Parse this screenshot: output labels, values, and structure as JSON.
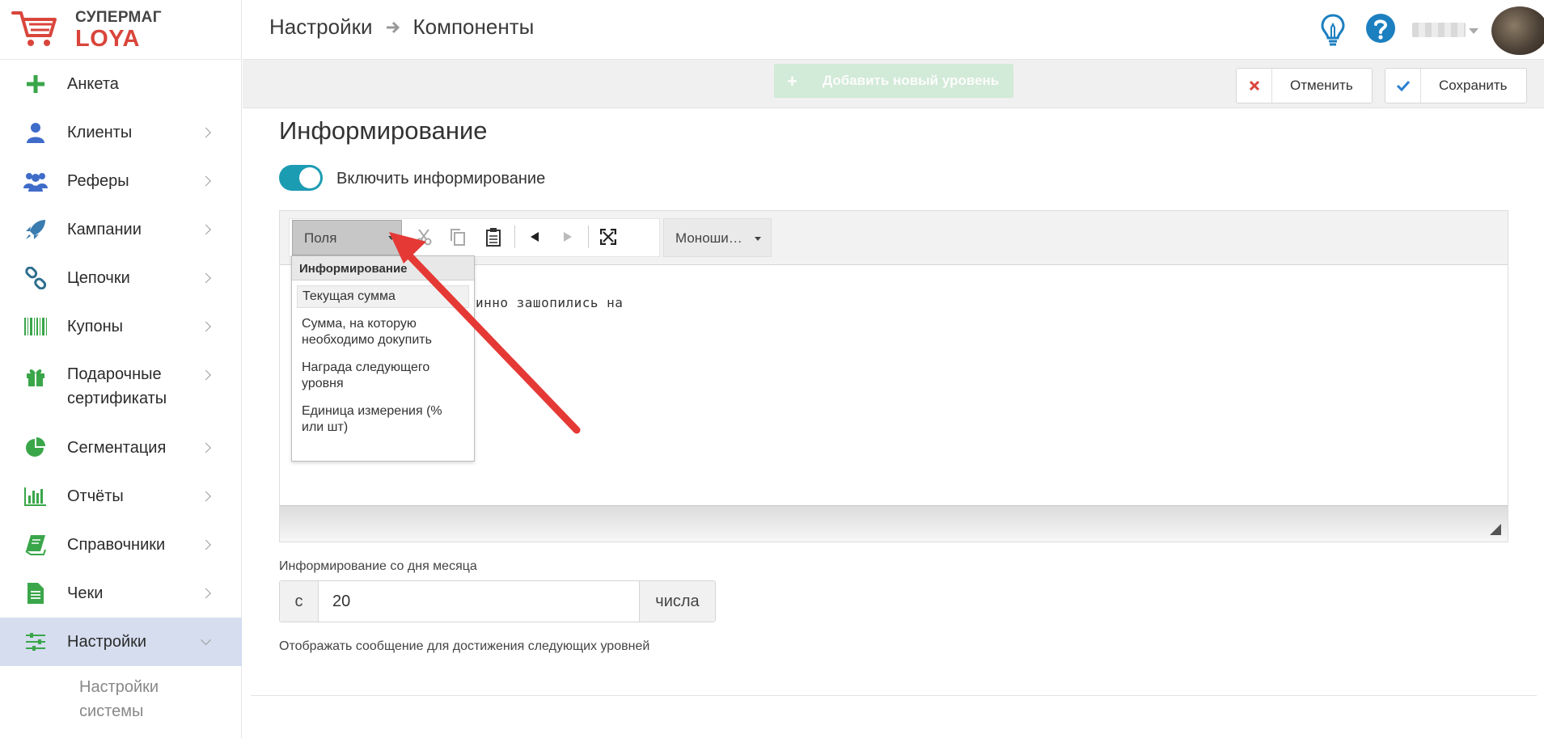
{
  "logo": {
    "brand_top": "СУПЕРМАГ",
    "brand_bottom": "LOYA"
  },
  "sidebar": {
    "items": [
      {
        "label": "Анкета",
        "icon": "plus-icon"
      },
      {
        "label": "Клиенты",
        "icon": "user-icon"
      },
      {
        "label": "Реферы",
        "icon": "users-icon"
      },
      {
        "label": "Кампании",
        "icon": "rocket-icon"
      },
      {
        "label": "Цепочки",
        "icon": "link-icon"
      },
      {
        "label": "Купоны",
        "icon": "barcode-icon"
      },
      {
        "label": "Подарочные сертификаты",
        "icon": "gift-icon"
      },
      {
        "label": "Сегментация",
        "icon": "pie-chart-icon"
      },
      {
        "label": "Отчёты",
        "icon": "bar-chart-icon"
      },
      {
        "label": "Справочники",
        "icon": "book-icon"
      },
      {
        "label": "Чеки",
        "icon": "document-icon"
      },
      {
        "label": "Настройки",
        "icon": "sliders-icon",
        "active": true
      }
    ],
    "sub_item": "Настройки системы"
  },
  "header": {
    "breadcrumb": [
      "Настройки",
      "Компоненты"
    ]
  },
  "actionbar": {
    "add_level": "Добавить новый уровень",
    "cancel": "Отменить",
    "save": "Сохранить"
  },
  "main": {
    "title": "Информирование",
    "toggle_label": "Включить информирование",
    "toggle_on": true,
    "editor": {
      "fields_combo": "Поля",
      "font_combo": "Моноши…",
      "text": "инно зашопились на",
      "dropdown": {
        "header": "Информирование",
        "items": [
          "Текущая сумма",
          "Сумма, на которую необходимо докупить",
          "Награда следующего уровня",
          "Единица измерения (% или шт)"
        ]
      }
    },
    "day_label": "Информирование со дня месяца",
    "day_prefix": "с",
    "day_value": "20",
    "day_suffix": "числа",
    "levels_label": "Отображать сообщение для достижения следующих уровней"
  },
  "colors": {
    "accent": "#1c9cb3",
    "brand_red": "#d9453b",
    "sidebar_active": "#d5ddef",
    "icon_green": "#3aa64a",
    "icon_blue": "#3f6cc9",
    "arrow_red": "#e53935"
  }
}
